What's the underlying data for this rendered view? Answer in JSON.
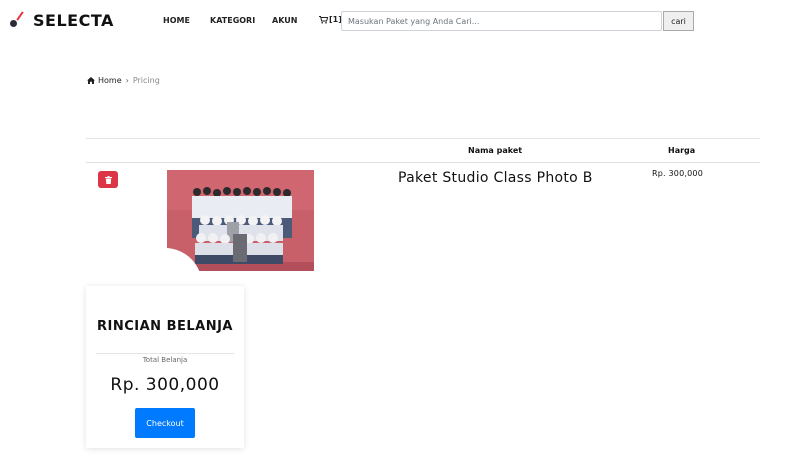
{
  "brand": {
    "name": "SELECTA",
    "accent": "#e03545"
  },
  "nav": {
    "home": "HOME",
    "kategori": "KATEGORI",
    "akun": "AKUN"
  },
  "cart": {
    "icon": "cart-icon",
    "count": "[1]"
  },
  "search": {
    "placeholder": "Masukan Paket yang Anda Cari...",
    "button": "cari"
  },
  "breadcrumb": {
    "home": "Home",
    "separator": "›",
    "current": "Pricing"
  },
  "table": {
    "headers": {
      "name": "Nama paket",
      "price": "Harga"
    },
    "rows": [
      {
        "name": "Paket Studio Class Photo B",
        "price": "Rp. 300,000",
        "delete_icon": "trash-icon"
      }
    ]
  },
  "summary": {
    "title": "RINCIAN BELANJA",
    "subtitle": "Total Belanja",
    "total": "Rp. 300,000",
    "checkout": "Checkout",
    "button_color": "#007bff"
  },
  "colors": {
    "danger": "#dc3545",
    "primary": "#007bff"
  }
}
